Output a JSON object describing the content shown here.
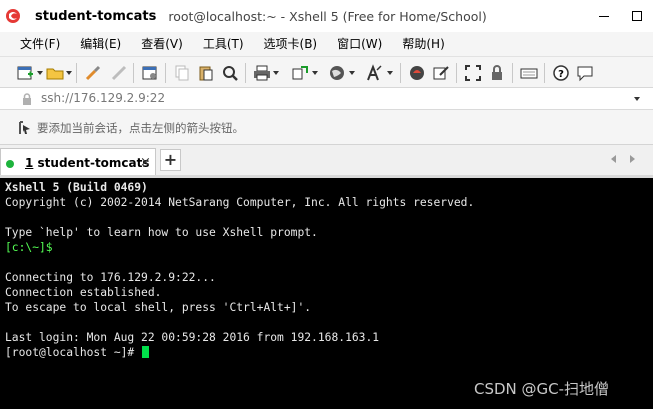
{
  "window": {
    "app_title_bold": "student-tomcats",
    "app_title_rest": "root@localhost:~ - Xshell 5 (Free for Home/School)"
  },
  "menu": [
    "文件(F)",
    "编辑(E)",
    "查看(V)",
    "工具(T)",
    "选项卡(B)",
    "窗口(W)",
    "帮助(H)"
  ],
  "address": {
    "value": "ssh://176.129.2.9:22"
  },
  "hint": {
    "text": "要添加当前会话，点击左侧的箭头按钮。"
  },
  "tabs": {
    "active_number": "1",
    "active_label": " student-tomcats",
    "close_glyph": "×",
    "add_glyph": "+"
  },
  "terminal": {
    "line1": "Xshell 5 (Build 0469)",
    "line2": "Copyright (c) 2002-2014 NetSarang Computer, Inc. All rights reserved.",
    "line3": "Type `help' to learn how to use Xshell prompt.",
    "line4": "[c:\\~]$",
    "line5": "Connecting to 176.129.2.9:22...",
    "line6": "Connection established.",
    "line7": "To escape to local shell, press 'Ctrl+Alt+]'.",
    "line8": "Last login: Mon Aug 22 00:59:28 2016 from 192.168.163.1",
    "line9": "[root@localhost ~]# "
  },
  "watermark": "CSDN @GC-扫地僧",
  "colors": {
    "terminal_bg": "#000000",
    "prompt_green": "#55ff55",
    "cursor": "#00e04a",
    "tab_dot": "#1db33c"
  }
}
